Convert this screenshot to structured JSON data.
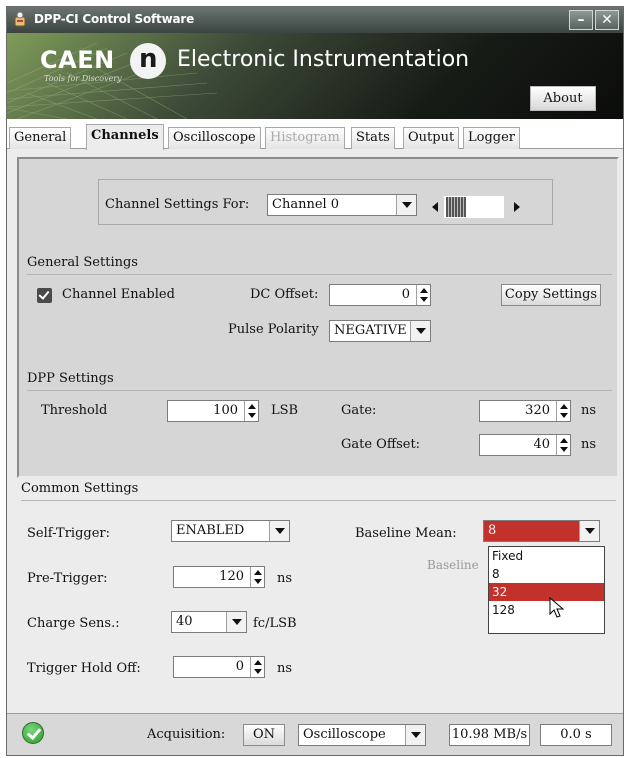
{
  "window": {
    "title": "DPP-CI Control Software"
  },
  "banner": {
    "brand": "CAEN",
    "tagline": "Tools for Discovery",
    "n_logo": "n",
    "title": "Electronic Instrumentation",
    "about_label": "About"
  },
  "tabs": [
    {
      "label": "General",
      "active": false,
      "enabled": true
    },
    {
      "label": "Channels",
      "active": true,
      "enabled": true
    },
    {
      "label": "Oscilloscope",
      "active": false,
      "enabled": true
    },
    {
      "label": "Histogram",
      "active": false,
      "enabled": false
    },
    {
      "label": "Stats",
      "active": false,
      "enabled": true
    },
    {
      "label": "Output",
      "active": false,
      "enabled": true
    },
    {
      "label": "Logger",
      "active": false,
      "enabled": true
    }
  ],
  "channel_select": {
    "label": "Channel Settings For:",
    "value": "Channel 0"
  },
  "general_settings": {
    "title": "General Settings",
    "channel_enabled_label": "Channel Enabled",
    "channel_enabled": true,
    "dc_offset_label": "DC Offset:",
    "dc_offset": "0",
    "copy_settings_label": "Copy Settings",
    "pulse_polarity_label": "Pulse Polarity",
    "pulse_polarity": "NEGATIVE"
  },
  "dpp_settings": {
    "title": "DPP Settings",
    "threshold_label": "Threshold",
    "threshold": "100",
    "threshold_unit": "LSB",
    "gate_label": "Gate:",
    "gate": "320",
    "gate_unit": "ns",
    "gate_offset_label": "Gate Offset:",
    "gate_offset": "40",
    "gate_offset_unit": "ns"
  },
  "common_settings": {
    "title": "Common Settings",
    "self_trigger_label": "Self-Trigger:",
    "self_trigger": "ENABLED",
    "pre_trigger_label": "Pre-Trigger:",
    "pre_trigger": "120",
    "pre_trigger_unit": "ns",
    "charge_sens_label": "Charge Sens.:",
    "charge_sens": "40",
    "charge_sens_unit": "fc/LSB",
    "trigger_holdoff_label": "Trigger Hold Off:",
    "trigger_holdoff": "0",
    "trigger_holdoff_unit": "ns",
    "baseline_mean_label": "Baseline Mean:",
    "baseline_mean": "8",
    "baseline_partial_label": "Baseline",
    "baseline_options": [
      "Fixed",
      "8",
      "32",
      "128"
    ],
    "baseline_highlighted": "32"
  },
  "status_bar": {
    "acquisition_label": "Acquisition:",
    "acquisition_state": "ON",
    "mode": "Oscilloscope",
    "rate": "10.98 MB/s",
    "time": "0.0 s"
  },
  "colors": {
    "highlight": "#c3312c",
    "ok": "#2c9a2c",
    "panel": "#d6d6d6"
  }
}
